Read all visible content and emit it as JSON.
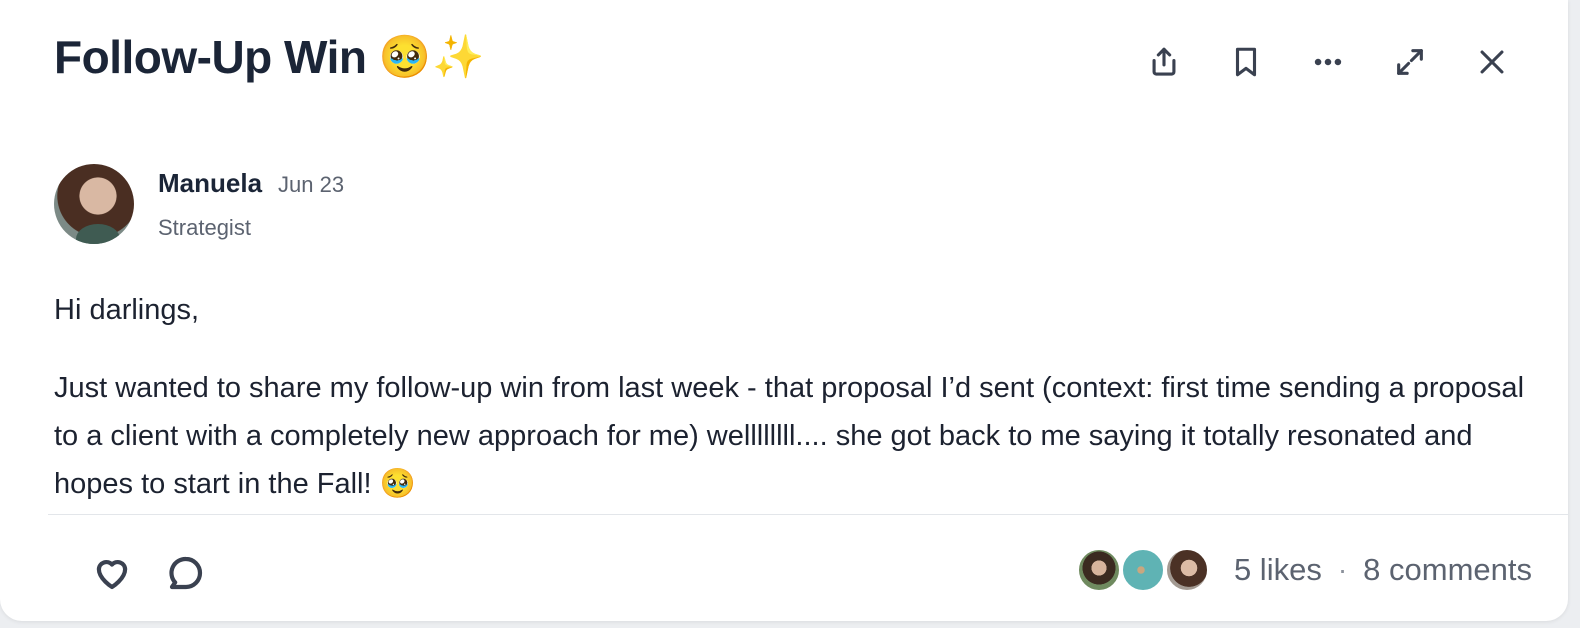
{
  "post": {
    "title": "Follow-Up Win",
    "title_emojis": [
      "🥹",
      "✨"
    ]
  },
  "toolbar": {
    "icons": [
      "share-icon",
      "bookmark-icon",
      "more-icon",
      "expand-icon",
      "close-icon"
    ]
  },
  "author": {
    "name": "Manuela",
    "date": "Jun 23",
    "role": "Strategist"
  },
  "body": {
    "greeting": "Hi darlings,",
    "message": "Just wanted to share my follow-up win from last week - that proposal I’d sent (context: first time sending a proposal to a client with a completely new approach for me) wellllllll.... she got back to me saying it totally resonated and hopes to start in the Fall! 🥹"
  },
  "footer": {
    "likes": "5 likes",
    "separator": "·",
    "comments": "8 comments"
  }
}
